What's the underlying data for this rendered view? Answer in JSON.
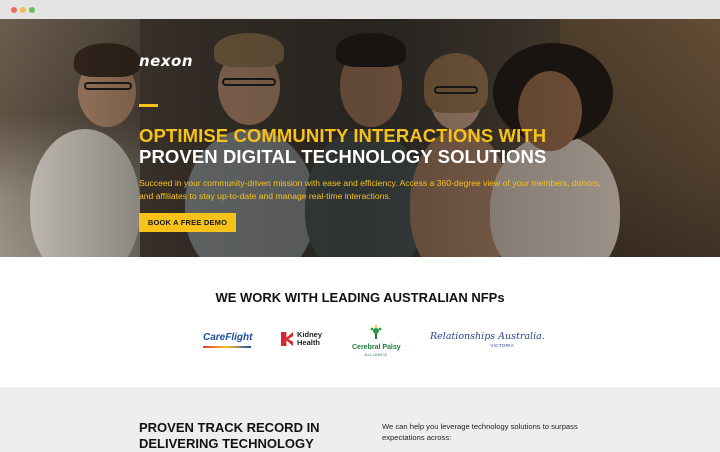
{
  "hero": {
    "logo": "nexon",
    "headline_line1": "OPTIMISE COMMUNITY INTERACTIONS WITH",
    "headline_line2": "PROVEN DIGITAL TECHNOLOGY SOLUTIONS",
    "subtext_line1": "Succeed in your community-driven mission with ease and efficiency. Access a 360-degree view of your members, donors,",
    "subtext_line2": "and affiliates to stay up-to-date and manage real-time interactions.",
    "cta_label": "BOOK A FREE DEMO"
  },
  "partners": {
    "title": "WE WORK WITH LEADING AUSTRALIAN NFPs",
    "logos": [
      {
        "name": "CareFlight"
      },
      {
        "line1": "Kidney",
        "line2": "Health"
      },
      {
        "line1": "Cerebral Palsy",
        "line2": "ALLIANCE"
      },
      {
        "line1": "Relationships Australia.",
        "line2": "VICTORIA"
      }
    ]
  },
  "track_record": {
    "title_line1": "PROVEN TRACK RECORD IN",
    "title_line2": "DELIVERING TECHNOLOGY",
    "text_line1": "We can help you leverage technology solutions to surpass",
    "text_line2": "expectations across:"
  },
  "colors": {
    "accent": "#f7c21a",
    "section_bg": "#eeeeee"
  }
}
